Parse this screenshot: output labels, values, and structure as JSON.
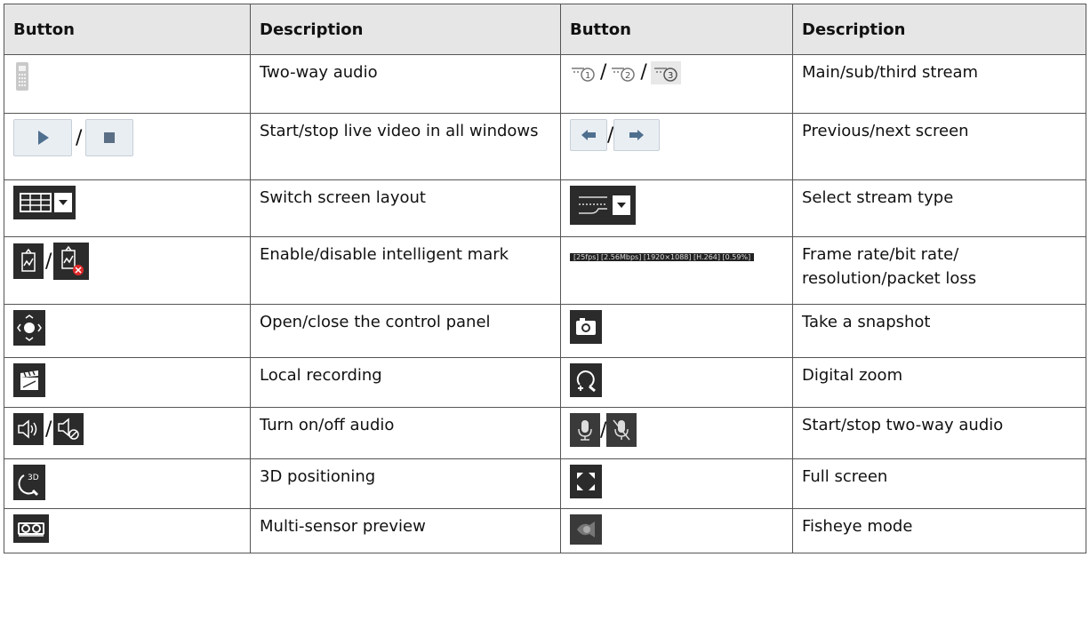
{
  "headers": {
    "button1": "Button",
    "description1": "Description",
    "button2": "Button",
    "description2": "Description"
  },
  "rows": [
    {
      "left_icon": "phone-icon",
      "left_desc": "Two-way audio",
      "right_icon": "stream-select-icons",
      "right_desc": "Main/sub/third stream"
    },
    {
      "left_icon": "play-stop-icons",
      "left_desc": "Start/stop live video in all windows",
      "right_icon": "prev-next-icons",
      "right_desc": "Previous/next screen"
    },
    {
      "left_icon": "grid-layout-icon",
      "left_desc": "Switch screen layout",
      "right_icon": "stream-type-icon",
      "right_desc": "Select stream type"
    },
    {
      "left_icon": "intelligent-mark-icons",
      "left_desc": "Enable/disable intelligent mark",
      "right_icon": "stats-overlay",
      "right_desc": "Frame rate/bit rate/ resolution/packet loss"
    },
    {
      "left_icon": "control-panel-icon",
      "left_desc": "Open/close the control panel",
      "right_icon": "camera-icon",
      "right_desc": "Take a snapshot"
    },
    {
      "left_icon": "clapper-icon",
      "left_desc": "Local recording",
      "right_icon": "zoom-icon",
      "right_desc": "Digital zoom"
    },
    {
      "left_icon": "speaker-icons",
      "left_desc": "Turn on/off audio",
      "right_icon": "mic-icons",
      "right_desc": "Start/stop two-way audio"
    },
    {
      "left_icon": "3d-positioning-icon",
      "left_desc": "3D positioning",
      "right_icon": "fullscreen-icon",
      "right_desc": "Full screen"
    },
    {
      "left_icon": "multi-sensor-icon",
      "left_desc": "Multi-sensor preview",
      "right_icon": "fisheye-icon",
      "right_desc": "Fisheye mode"
    }
  ],
  "stats_overlay_text": "[25fps] [2.56Mbps] [1920×1088] [H.264] [0.59%]",
  "three_d_label": "3D",
  "separator": "/"
}
